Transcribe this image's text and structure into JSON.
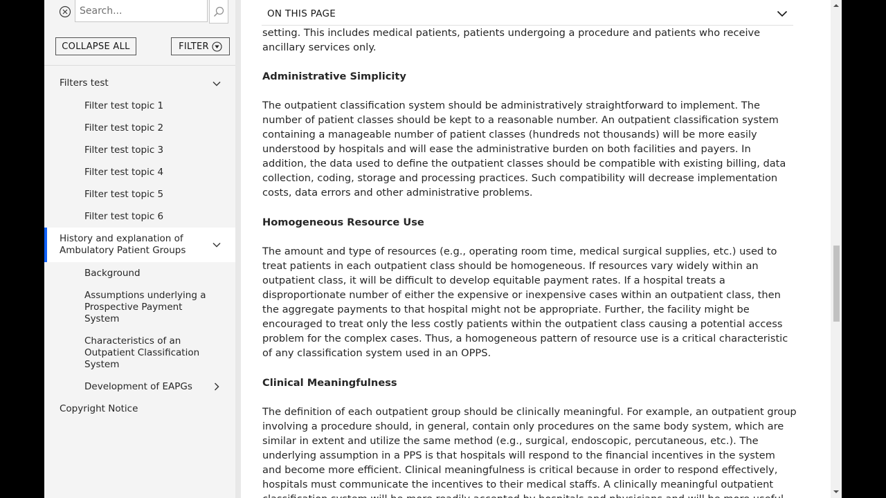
{
  "sidebar": {
    "search": {
      "placeholder": "Search..."
    },
    "collapse_label": "COLLAPSE ALL",
    "filter_label": "FILTER",
    "nav": [
      {
        "label": "Filters test",
        "level": 1,
        "chevron": "down"
      },
      {
        "label": "Filter test topic 1",
        "level": 2
      },
      {
        "label": "Filter test topic 2",
        "level": 2
      },
      {
        "label": "Filter test topic 3",
        "level": 2
      },
      {
        "label": "Filter test topic 4",
        "level": 2
      },
      {
        "label": "Filter test topic 5",
        "level": 2
      },
      {
        "label": "Filter test topic 6",
        "level": 2
      },
      {
        "label": "History and explanation of Ambulatory Patient Groups",
        "level": 1,
        "chevron": "down",
        "active": true
      },
      {
        "label": "Background",
        "level": 2
      },
      {
        "label": "Assumptions underlying a Prospective Payment System",
        "level": 2
      },
      {
        "label": "Characteristics of an Outpatient Classification System",
        "level": 2
      },
      {
        "label": "Development of EAPGs",
        "level": 2,
        "chevron": "right"
      },
      {
        "label": "Copyright Notice",
        "level": 1
      }
    ]
  },
  "main": {
    "on_this_page": "ON THIS PAGE",
    "intro_tail": "setting. This includes medical patients, patients undergoing a procedure and patients who receive ancillary services only.",
    "sections": [
      {
        "heading": "Administrative Simplicity",
        "body": "The outpatient classification system should be administratively straightforward to implement. The number of patient classes should be kept to a reasonable number. An outpatient classification system containing a manageable number of patient classes (hundreds not thousands) will be more easily understood by hospitals and will ease the administrative burden on both facilities and payers. In addition, the data used to define the outpatient classes should be compatible with existing billing, data collection, coding, storage and processing practices. Such compatibility will decrease implementation costs, data errors and other administrative problems."
      },
      {
        "heading": "Homogeneous Resource Use",
        "body": "The amount and type of resources (e.g., operating room time, medical surgical supplies, etc.) used to treat patients in each outpatient class should be homogeneous. If resources vary widely within an outpatient class, it will be difficult to develop equitable payment rates. If a hospital treats a disproportionate number of either the expensive or inexpensive cases within an outpatient class, then the aggregate payments to that hospital might not be appropriate. Further, the facility might be encouraged to treat only the less costly patients within the outpatient class causing a potential access problem for the complex cases. Thus, a homogeneous pattern of resource use is a critical characteristic of any classification system used in an OPPS."
      },
      {
        "heading": "Clinical Meaningfulness",
        "body": "The definition of each outpatient group should be clinically meaningful. For example, an outpatient group involving a procedure should, in general, contain only procedures on the same body system, which are similar in extent and utilize the same method (e.g., surgical, endoscopic, percutaneous, etc.). The underlying assumption in a PPS is that hospitals will respond to the financial incentives in the system and become more efficient. Clinical meaningfulness is critical because in order to respond effectively, hospitals must communicate the incentives to their medical staffs. A clinically meaningful outpatient classification system will be more readily accepted by hospitals and physicians and will be more useful as"
      }
    ]
  }
}
